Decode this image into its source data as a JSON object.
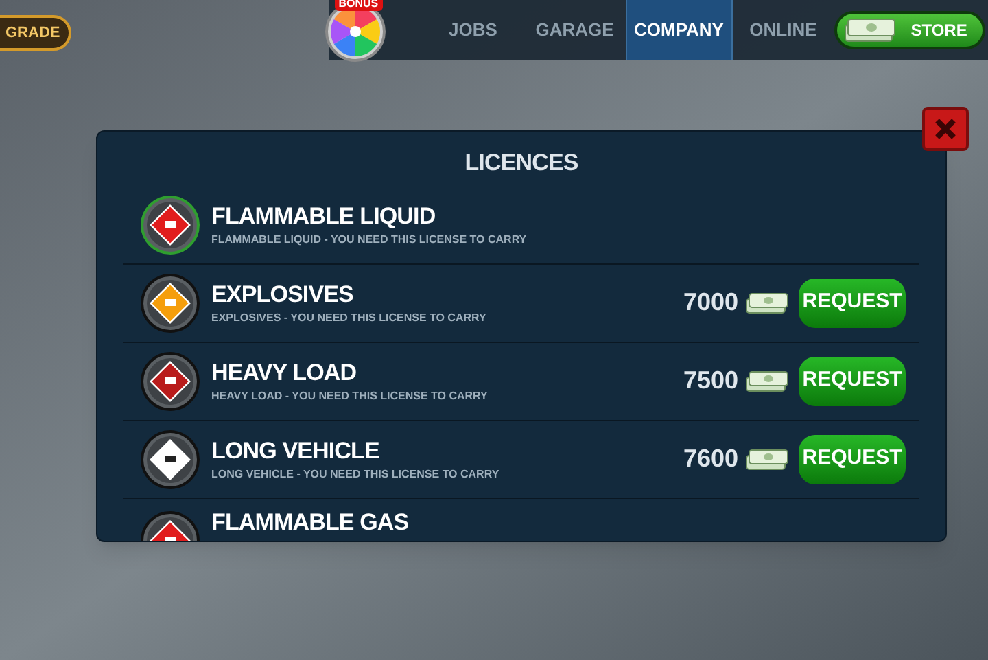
{
  "top_bar": {
    "upgrade_button": "GRADE",
    "bonus_badge": "BONUS",
    "tabs": [
      {
        "label": "JOBS",
        "selected": false
      },
      {
        "label": "GARAGE",
        "selected": false
      },
      {
        "label": "COMPANY",
        "selected": true
      },
      {
        "label": "ONLINE",
        "selected": false
      }
    ],
    "store_button": "STORE"
  },
  "dialog": {
    "title": "LICENCES",
    "licences": [
      {
        "name": "FLAMMABLE LIQUID",
        "description": "FLAMMABLE LIQUID - YOU NEED THIS LICENSE TO CARRY",
        "owned": true,
        "color": "#e11d1d"
      },
      {
        "name": "EXPLOSIVES",
        "description": "EXPLOSIVES - YOU NEED THIS LICENSE TO CARRY",
        "owned": false,
        "color": "#f59e0b",
        "price": "7000",
        "button": "REQUEST"
      },
      {
        "name": "HEAVY LOAD",
        "description": "HEAVY LOAD - YOU NEED THIS LICENSE TO CARRY",
        "owned": false,
        "color": "#b91c1c",
        "price": "7500",
        "button": "REQUEST"
      },
      {
        "name": "LONG VEHICLE",
        "description": "LONG VEHICLE - YOU NEED THIS LICENSE TO CARRY",
        "owned": false,
        "color": "#ffffff",
        "price": "7600",
        "button": "REQUEST"
      },
      {
        "name": "FLAMMABLE GAS",
        "owned": false,
        "color": "#e11d1d"
      }
    ]
  }
}
